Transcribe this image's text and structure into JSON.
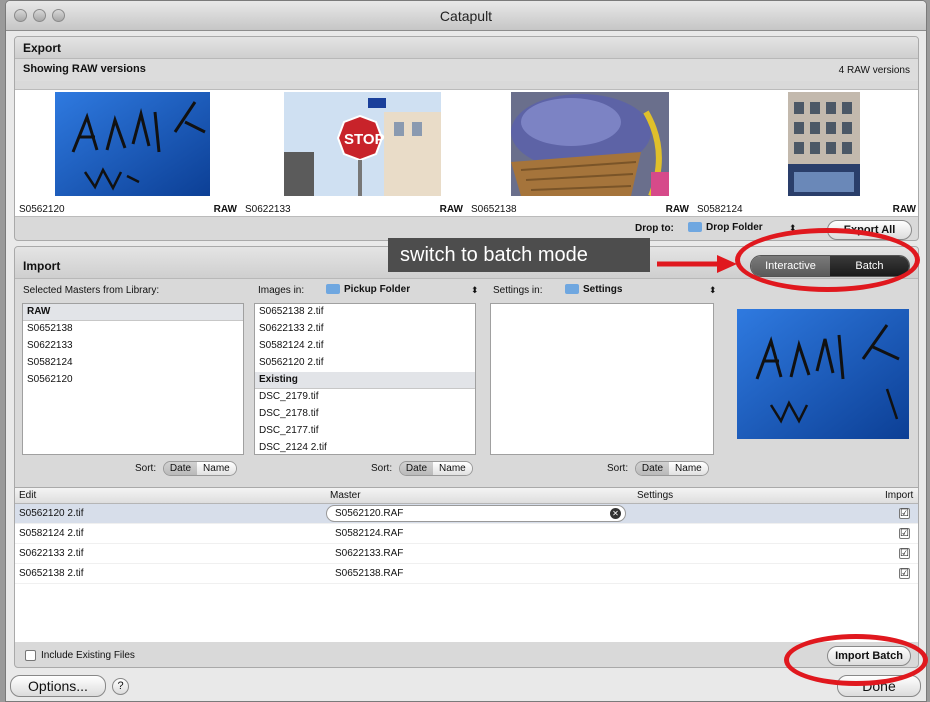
{
  "window": {
    "title": "Catapult"
  },
  "export": {
    "title": "Export",
    "showing": "Showing RAW versions",
    "count": "4 RAW versions",
    "thumbs": [
      {
        "name": "S0562120",
        "badge": "RAW"
      },
      {
        "name": "S0622133",
        "badge": "RAW"
      },
      {
        "name": "S0652138",
        "badge": "RAW"
      },
      {
        "name": "S0582124",
        "badge": "RAW"
      }
    ],
    "drop_to_label": "Drop to:",
    "drop_folder": "Drop Folder",
    "export_all": "Export All"
  },
  "import": {
    "title": "Import",
    "mode_interactive": "Interactive",
    "mode_batch": "Batch",
    "masters_label": "Selected Masters from Library:",
    "masters": {
      "group": "RAW",
      "items": [
        "S0652138",
        "S0622133",
        "S0582124",
        "S0562120"
      ]
    },
    "images_in_label": "Images in:",
    "images_folder": "Pickup Folder",
    "images": [
      "S0652138 2.tif",
      "S0622133 2.tif",
      "S0582124 2.tif",
      "S0562120 2.tif"
    ],
    "existing_group": "Existing",
    "existing": [
      "DSC_2179.tif",
      "DSC_2178.tif",
      "DSC_2177.tif",
      "DSC_2124 2.tif"
    ],
    "settings_in_label": "Settings in:",
    "settings_folder": "Settings",
    "sort_label": "Sort:",
    "sort_date": "Date",
    "sort_name": "Name",
    "table": {
      "headers": [
        "Edit",
        "Master",
        "Settings",
        "Import"
      ],
      "rows": [
        {
          "edit": "S0562120 2.tif",
          "master": "S0562120.RAF",
          "settings": "",
          "import": "☑"
        },
        {
          "edit": "S0582124 2.tif",
          "master": "S0582124.RAF",
          "settings": "",
          "import": "☑"
        },
        {
          "edit": "S0622133 2.tif",
          "master": "S0622133.RAF",
          "settings": "",
          "import": "☑"
        },
        {
          "edit": "S0652138 2.tif",
          "master": "S0652138.RAF",
          "settings": "",
          "import": "☑"
        }
      ]
    },
    "include_existing": "Include Existing Files",
    "import_batch": "Import Batch"
  },
  "footer": {
    "options": "Options...",
    "help": "?",
    "done": "Done"
  },
  "annotation": {
    "callout": "switch to batch mode"
  },
  "colors": {
    "annotation_red": "#e0181e",
    "selection": "#d7deea",
    "folder_blue": "#6fa7e0"
  }
}
